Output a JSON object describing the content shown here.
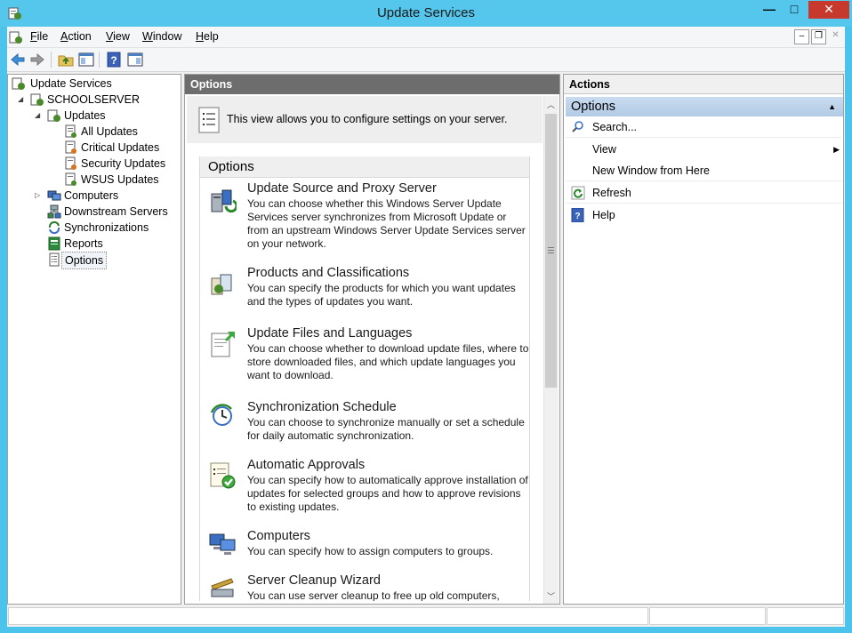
{
  "window": {
    "title": "Update Services",
    "controls": {
      "minimize": "—",
      "maximize": "□",
      "close": "✕"
    },
    "mdi_controls": {
      "minimize": "–",
      "restore": "❐",
      "close": "✕"
    }
  },
  "menu": [
    {
      "label": "File",
      "accel": "F",
      "rest": "ile"
    },
    {
      "label": "Action",
      "accel": "A",
      "rest": "ction"
    },
    {
      "label": "View",
      "accel": "V",
      "rest": "iew"
    },
    {
      "label": "Window",
      "accel": "W",
      "rest": "indow"
    },
    {
      "label": "Help",
      "accel": "H",
      "rest": "elp"
    }
  ],
  "tree": {
    "root": "Update Services",
    "server": "SCHOOLSERVER",
    "updates": "Updates",
    "all_updates": "All Updates",
    "critical_updates": "Critical Updates",
    "security_updates": "Security Updates",
    "wsus_updates": "WSUS Updates",
    "computers": "Computers",
    "downstream_servers": "Downstream Servers",
    "synchronizations": "Synchronizations",
    "reports": "Reports",
    "options": "Options"
  },
  "center": {
    "header": "Options",
    "info": "This view allows you to configure settings on your server.",
    "section_title": "Options",
    "items": [
      {
        "title": "Update Source and Proxy Server",
        "desc": "You can choose whether this Windows Server Update Services server synchronizes from Microsoft Update or from an upstream Windows Server Update Services server on your network."
      },
      {
        "title": "Products and Classifications",
        "desc": "You can specify the products for which you want updates and the types of updates you want."
      },
      {
        "title": "Update Files and Languages",
        "desc": "You can choose whether to download update files, where to store downloaded files, and which update languages you want to download."
      },
      {
        "title": "Synchronization Schedule",
        "desc": "You can choose to synchronize manually or set a schedule for daily automatic synchronization."
      },
      {
        "title": "Automatic Approvals",
        "desc": "You can specify how to automatically approve installation of updates for selected groups and how to approve revisions to existing updates."
      },
      {
        "title": "Computers",
        "desc": "You can specify how to assign computers to groups."
      },
      {
        "title": "Server Cleanup Wizard",
        "desc": "You can use server cleanup to free up old computers,"
      }
    ]
  },
  "actions": {
    "header": "Actions",
    "group": "Options",
    "items": [
      "Search...",
      "View",
      "New Window from Here",
      "Refresh",
      "Help"
    ]
  }
}
